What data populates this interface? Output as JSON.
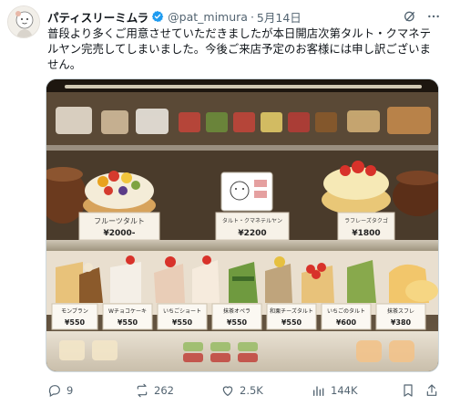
{
  "post": {
    "display_name": "パティスリーミムラ",
    "handle": "@pat_mimura",
    "separator": "·",
    "date": "5月14日",
    "text": "普段より多くご用意させていただきましたが本日開店次第タルト・クマネテルヤン完売してしまいました。今後ご来店予定のお客様には申し訳ございません。"
  },
  "photo": {
    "signs": {
      "fruit_tart": "フルーツタルト",
      "fruit_tart_price": "¥2000-",
      "kumanete": "タルト・クマネテルヤン",
      "kumanete_price": "¥2200",
      "cream_price": "¥1800",
      "cream_label": "ラフレーズタクゴ",
      "cake1": "モンブラン",
      "cake1_price": "¥550",
      "cake2": "Wチョコケーキ",
      "cake2_price": "¥550",
      "cake3": "いちごショート",
      "cake3_price": "¥550",
      "cake4": "抹茶オペラ",
      "cake4_price": "¥550",
      "cake5": "和栗チーズタルト",
      "cake5_price": "¥550",
      "cake6": "いちごのタルト",
      "cake6_price": "¥600",
      "cake7": "抹茶スフレ",
      "cake7_price": "¥380"
    }
  },
  "actions": {
    "replies": "9",
    "reposts": "262",
    "likes": "2.5K",
    "views": "144K"
  },
  "colors": {
    "verified": "#1d9bf0",
    "muted": "#536471"
  }
}
